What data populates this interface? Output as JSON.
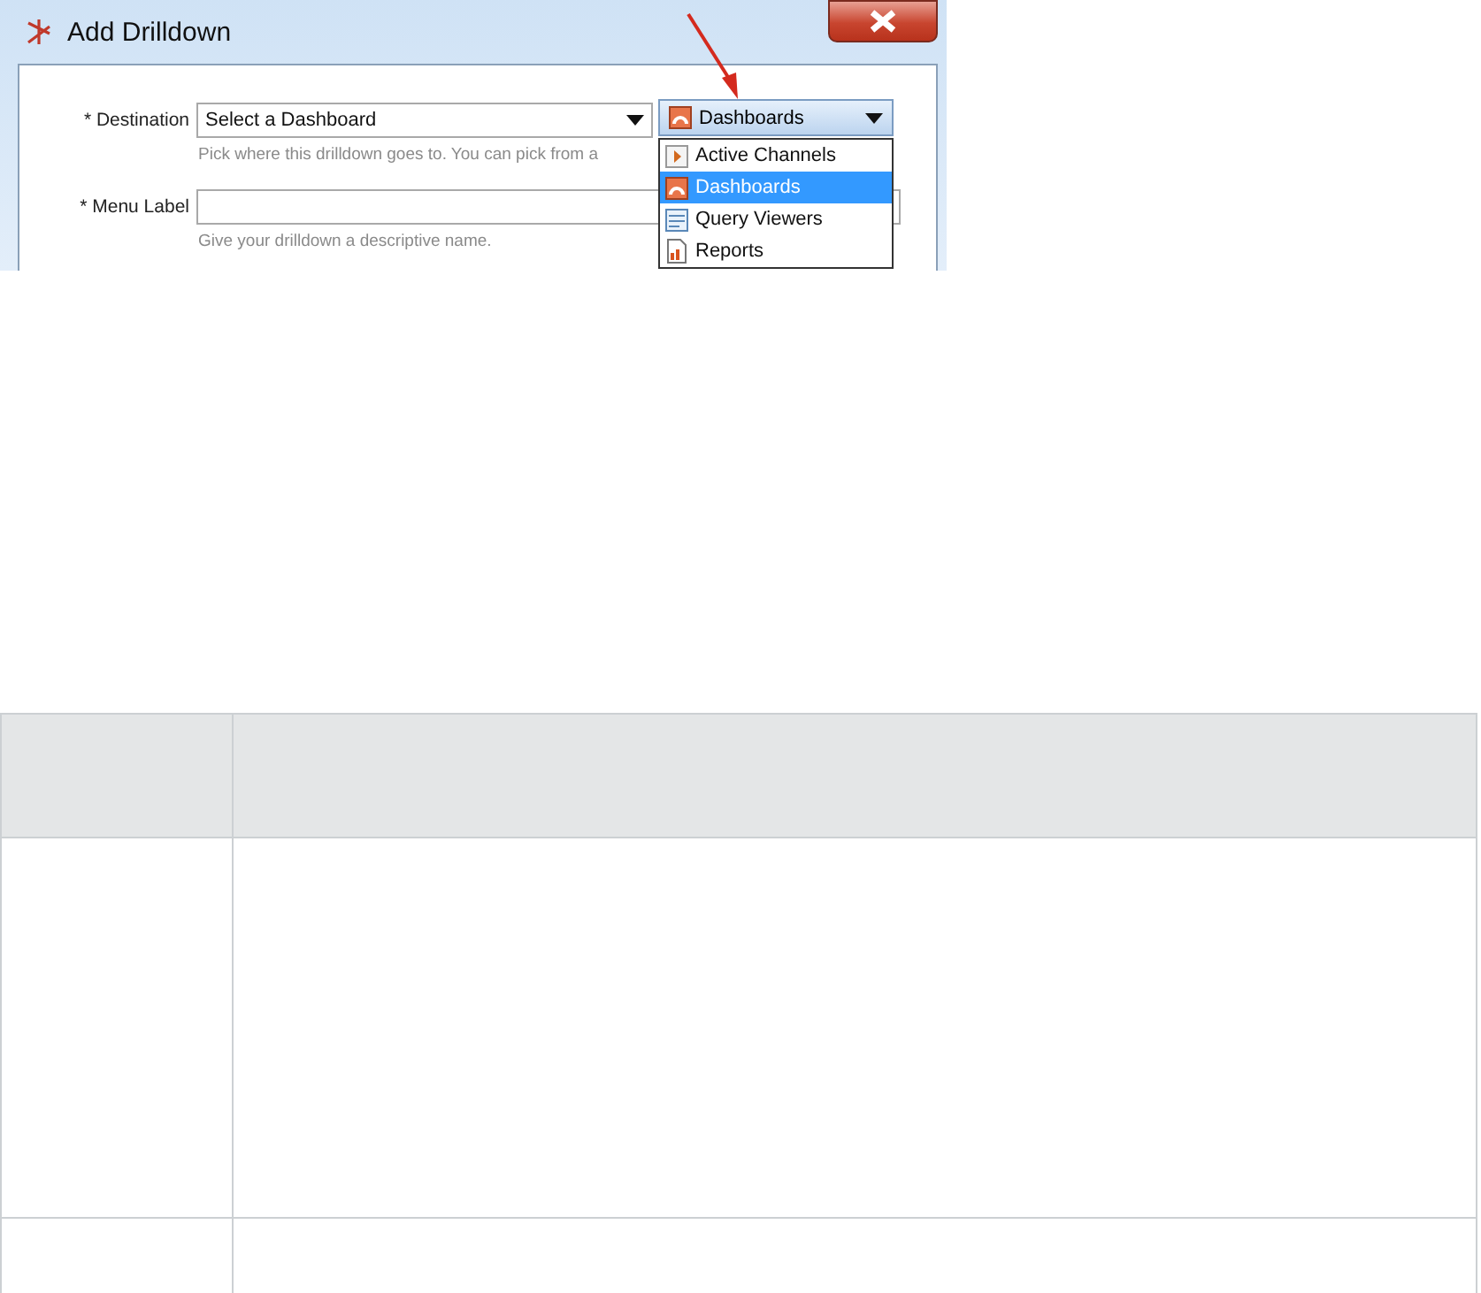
{
  "dialog": {
    "title": "Add Drilldown",
    "fields": [
      {
        "required_mark": "*",
        "label": "Destination",
        "kind": "select",
        "value": "Select a Dashboard",
        "hint": "Pick where this drilldown goes to. You can pick from a"
      },
      {
        "required_mark": "*",
        "label": "Menu Label",
        "kind": "text",
        "hint": "Give your drilldown a descriptive name."
      }
    ],
    "type_select": {
      "value": "Dashboards",
      "options": [
        {
          "label": "Active Channels",
          "kind": "channel",
          "selected": false
        },
        {
          "label": "Dashboards",
          "kind": "dashboard",
          "selected": true
        },
        {
          "label": "Query Viewers",
          "kind": "viewer",
          "selected": false
        },
        {
          "label": "Reports",
          "kind": "report",
          "selected": false
        }
      ]
    }
  }
}
